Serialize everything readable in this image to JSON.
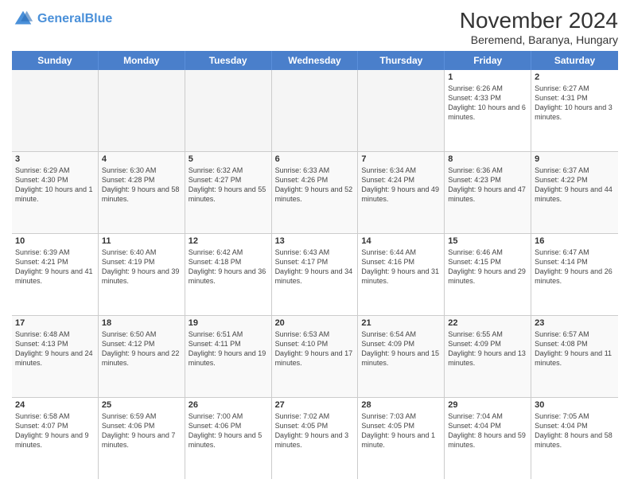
{
  "header": {
    "logo_line1": "General",
    "logo_line2": "Blue",
    "month": "November 2024",
    "location": "Beremend, Baranya, Hungary"
  },
  "weekdays": [
    "Sunday",
    "Monday",
    "Tuesday",
    "Wednesday",
    "Thursday",
    "Friday",
    "Saturday"
  ],
  "rows": [
    [
      {
        "day": "",
        "text": "",
        "empty": true
      },
      {
        "day": "",
        "text": "",
        "empty": true
      },
      {
        "day": "",
        "text": "",
        "empty": true
      },
      {
        "day": "",
        "text": "",
        "empty": true
      },
      {
        "day": "",
        "text": "",
        "empty": true
      },
      {
        "day": "1",
        "text": "Sunrise: 6:26 AM\nSunset: 4:33 PM\nDaylight: 10 hours and 6 minutes."
      },
      {
        "day": "2",
        "text": "Sunrise: 6:27 AM\nSunset: 4:31 PM\nDaylight: 10 hours and 3 minutes."
      }
    ],
    [
      {
        "day": "3",
        "text": "Sunrise: 6:29 AM\nSunset: 4:30 PM\nDaylight: 10 hours and 1 minute."
      },
      {
        "day": "4",
        "text": "Sunrise: 6:30 AM\nSunset: 4:28 PM\nDaylight: 9 hours and 58 minutes."
      },
      {
        "day": "5",
        "text": "Sunrise: 6:32 AM\nSunset: 4:27 PM\nDaylight: 9 hours and 55 minutes."
      },
      {
        "day": "6",
        "text": "Sunrise: 6:33 AM\nSunset: 4:26 PM\nDaylight: 9 hours and 52 minutes."
      },
      {
        "day": "7",
        "text": "Sunrise: 6:34 AM\nSunset: 4:24 PM\nDaylight: 9 hours and 49 minutes."
      },
      {
        "day": "8",
        "text": "Sunrise: 6:36 AM\nSunset: 4:23 PM\nDaylight: 9 hours and 47 minutes."
      },
      {
        "day": "9",
        "text": "Sunrise: 6:37 AM\nSunset: 4:22 PM\nDaylight: 9 hours and 44 minutes."
      }
    ],
    [
      {
        "day": "10",
        "text": "Sunrise: 6:39 AM\nSunset: 4:21 PM\nDaylight: 9 hours and 41 minutes."
      },
      {
        "day": "11",
        "text": "Sunrise: 6:40 AM\nSunset: 4:19 PM\nDaylight: 9 hours and 39 minutes."
      },
      {
        "day": "12",
        "text": "Sunrise: 6:42 AM\nSunset: 4:18 PM\nDaylight: 9 hours and 36 minutes."
      },
      {
        "day": "13",
        "text": "Sunrise: 6:43 AM\nSunset: 4:17 PM\nDaylight: 9 hours and 34 minutes."
      },
      {
        "day": "14",
        "text": "Sunrise: 6:44 AM\nSunset: 4:16 PM\nDaylight: 9 hours and 31 minutes."
      },
      {
        "day": "15",
        "text": "Sunrise: 6:46 AM\nSunset: 4:15 PM\nDaylight: 9 hours and 29 minutes."
      },
      {
        "day": "16",
        "text": "Sunrise: 6:47 AM\nSunset: 4:14 PM\nDaylight: 9 hours and 26 minutes."
      }
    ],
    [
      {
        "day": "17",
        "text": "Sunrise: 6:48 AM\nSunset: 4:13 PM\nDaylight: 9 hours and 24 minutes."
      },
      {
        "day": "18",
        "text": "Sunrise: 6:50 AM\nSunset: 4:12 PM\nDaylight: 9 hours and 22 minutes."
      },
      {
        "day": "19",
        "text": "Sunrise: 6:51 AM\nSunset: 4:11 PM\nDaylight: 9 hours and 19 minutes."
      },
      {
        "day": "20",
        "text": "Sunrise: 6:53 AM\nSunset: 4:10 PM\nDaylight: 9 hours and 17 minutes."
      },
      {
        "day": "21",
        "text": "Sunrise: 6:54 AM\nSunset: 4:09 PM\nDaylight: 9 hours and 15 minutes."
      },
      {
        "day": "22",
        "text": "Sunrise: 6:55 AM\nSunset: 4:09 PM\nDaylight: 9 hours and 13 minutes."
      },
      {
        "day": "23",
        "text": "Sunrise: 6:57 AM\nSunset: 4:08 PM\nDaylight: 9 hours and 11 minutes."
      }
    ],
    [
      {
        "day": "24",
        "text": "Sunrise: 6:58 AM\nSunset: 4:07 PM\nDaylight: 9 hours and 9 minutes."
      },
      {
        "day": "25",
        "text": "Sunrise: 6:59 AM\nSunset: 4:06 PM\nDaylight: 9 hours and 7 minutes."
      },
      {
        "day": "26",
        "text": "Sunrise: 7:00 AM\nSunset: 4:06 PM\nDaylight: 9 hours and 5 minutes."
      },
      {
        "day": "27",
        "text": "Sunrise: 7:02 AM\nSunset: 4:05 PM\nDaylight: 9 hours and 3 minutes."
      },
      {
        "day": "28",
        "text": "Sunrise: 7:03 AM\nSunset: 4:05 PM\nDaylight: 9 hours and 1 minute."
      },
      {
        "day": "29",
        "text": "Sunrise: 7:04 AM\nSunset: 4:04 PM\nDaylight: 8 hours and 59 minutes."
      },
      {
        "day": "30",
        "text": "Sunrise: 7:05 AM\nSunset: 4:04 PM\nDaylight: 8 hours and 58 minutes."
      }
    ]
  ]
}
